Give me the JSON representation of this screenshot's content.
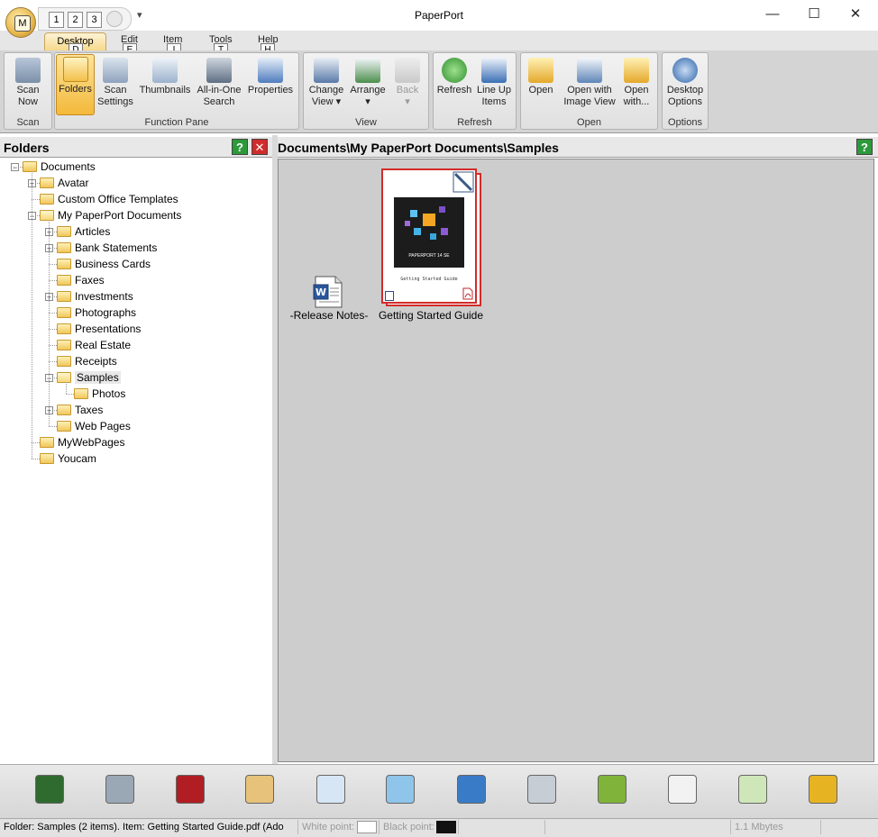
{
  "window": {
    "title": "PaperPort",
    "minimize": "—",
    "maximize": "☐",
    "close": "✕"
  },
  "app_button": {
    "letter": "M"
  },
  "quick_access": {
    "items": [
      "1",
      "2",
      "3"
    ],
    "more": "▾"
  },
  "tabs": [
    {
      "label": "Desktop",
      "key": "D"
    },
    {
      "label": "Edit",
      "key": "E"
    },
    {
      "label": "Item",
      "key": "I"
    },
    {
      "label": "Tools",
      "key": "T"
    },
    {
      "label": "Help",
      "key": "H"
    }
  ],
  "ribbon": {
    "groups": {
      "scan": "Scan",
      "function_pane": "Function Pane",
      "view": "View",
      "refresh": "Refresh",
      "open": "Open",
      "options": "Options"
    },
    "buttons": {
      "scan_now": [
        "Scan",
        "Now"
      ],
      "folders": [
        "Folders"
      ],
      "scan_settings": [
        "Scan",
        "Settings"
      ],
      "thumbnails": [
        "Thumbnails"
      ],
      "all_in_one": [
        "All-in-One",
        "Search"
      ],
      "properties": [
        "Properties"
      ],
      "change_view": [
        "Change",
        "View ▾"
      ],
      "arrange": [
        "Arrange",
        "▾"
      ],
      "back": [
        "Back",
        "▾"
      ],
      "refresh": [
        "Refresh"
      ],
      "line_up": [
        "Line Up",
        "Items"
      ],
      "open": [
        "Open"
      ],
      "open_image_view": [
        "Open with",
        "Image View"
      ],
      "open_with": [
        "Open",
        "with..."
      ],
      "desktop_options": [
        "Desktop",
        "Options"
      ]
    }
  },
  "folders_pane": {
    "title": "Folders",
    "help": "?",
    "close": "✕",
    "tree": [
      {
        "label": "Documents",
        "level": 0,
        "expander": "−"
      },
      {
        "label": "Avatar",
        "level": 1,
        "expander": "+"
      },
      {
        "label": "Custom Office Templates",
        "level": 1,
        "expander": ""
      },
      {
        "label": "My PaperPort Documents",
        "level": 1,
        "expander": "−"
      },
      {
        "label": "Articles",
        "level": 2,
        "expander": "+"
      },
      {
        "label": "Bank Statements",
        "level": 2,
        "expander": "+"
      },
      {
        "label": "Business Cards",
        "level": 2,
        "expander": ""
      },
      {
        "label": "Faxes",
        "level": 2,
        "expander": ""
      },
      {
        "label": "Investments",
        "level": 2,
        "expander": "+"
      },
      {
        "label": "Photographs",
        "level": 2,
        "expander": ""
      },
      {
        "label": "Presentations",
        "level": 2,
        "expander": ""
      },
      {
        "label": "Real Estate",
        "level": 2,
        "expander": ""
      },
      {
        "label": "Receipts",
        "level": 2,
        "expander": ""
      },
      {
        "label": "Samples",
        "level": 2,
        "expander": "−",
        "selected": true
      },
      {
        "label": "Photos",
        "level": 3,
        "expander": ""
      },
      {
        "label": "Taxes",
        "level": 2,
        "expander": "+"
      },
      {
        "label": "Web Pages",
        "level": 2,
        "expander": ""
      },
      {
        "label": "MyWebPages",
        "level": 1,
        "expander": ""
      },
      {
        "label": "Youcam",
        "level": 1,
        "expander": ""
      }
    ]
  },
  "content": {
    "path": "Documents\\My PaperPort Documents\\Samples",
    "help": "?",
    "items": [
      {
        "label": "-Release Notes-",
        "type": "word"
      },
      {
        "label": "Getting Started Guide",
        "type": "pdf",
        "cover_title": "PAPERPORT 14 SE",
        "cover_sub": "Getting Started Guide"
      }
    ]
  },
  "sendto_bar": [
    "evernote-icon",
    "printer-send-icon",
    "acrobat-icon",
    "paint-icon",
    "text-editor-icon",
    "notepad-icon",
    "ftp-icon",
    "fax-icon",
    "app-hex-icon",
    "people-icon",
    "recycle-icon",
    "scanner-icon"
  ],
  "status": {
    "message": "Folder: Samples (2 items). Item: Getting Started Guide.pdf (Ado",
    "white_point": "White point:",
    "black_point": "Black point:",
    "size": "1.1 Mbytes"
  }
}
